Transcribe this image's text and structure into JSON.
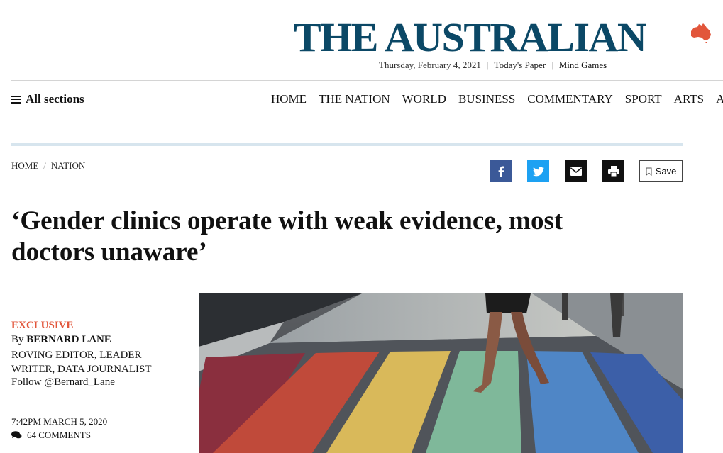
{
  "masthead": {
    "logo_text": "THE AUSTRALIAN",
    "logo_color": "#0b4866",
    "map_icon": "australia-map-icon",
    "map_color": "#e2563b",
    "date": "Thursday, February 4, 2021",
    "todays_paper": "Today's Paper",
    "mind_games": "Mind Games"
  },
  "nav": {
    "all_sections": "All sections",
    "items": [
      "HOME",
      "THE NATION",
      "WORLD",
      "BUSINESS",
      "COMMENTARY",
      "SPORT",
      "ARTS",
      "A"
    ]
  },
  "breadcrumb": {
    "home": "HOME",
    "section": "NATION"
  },
  "share": {
    "icons": [
      "facebook-icon",
      "twitter-icon",
      "email-icon",
      "print-icon"
    ],
    "colors": {
      "facebook": "#3b5998",
      "twitter": "#1da1f2",
      "email": "#111111",
      "print": "#111111"
    },
    "save_label": "Save"
  },
  "article": {
    "headline": "‘Gender clinics operate with weak evidence, most doctors unaware’",
    "kicker": "EXCLUSIVE",
    "kicker_color": "#e2563b",
    "by": "By",
    "author": "BERNARD LANE",
    "role": "ROVING EDITOR, LEADER WRITER, DATA JOURNALIST",
    "follow_label": "Follow",
    "follow_handle": "@Bernard_Lane",
    "timestamp": "7:42PM MARCH 5, 2020",
    "comments": "64 COMMENTS"
  },
  "hero_image": {
    "subject": "rainbow pedestrian crossing with barefoot walker",
    "stripe_colors": [
      "#8a2f3e",
      "#c04a3a",
      "#d9b95a",
      "#7fb89a",
      "#4f86c6",
      "#3c5fa8"
    ]
  }
}
